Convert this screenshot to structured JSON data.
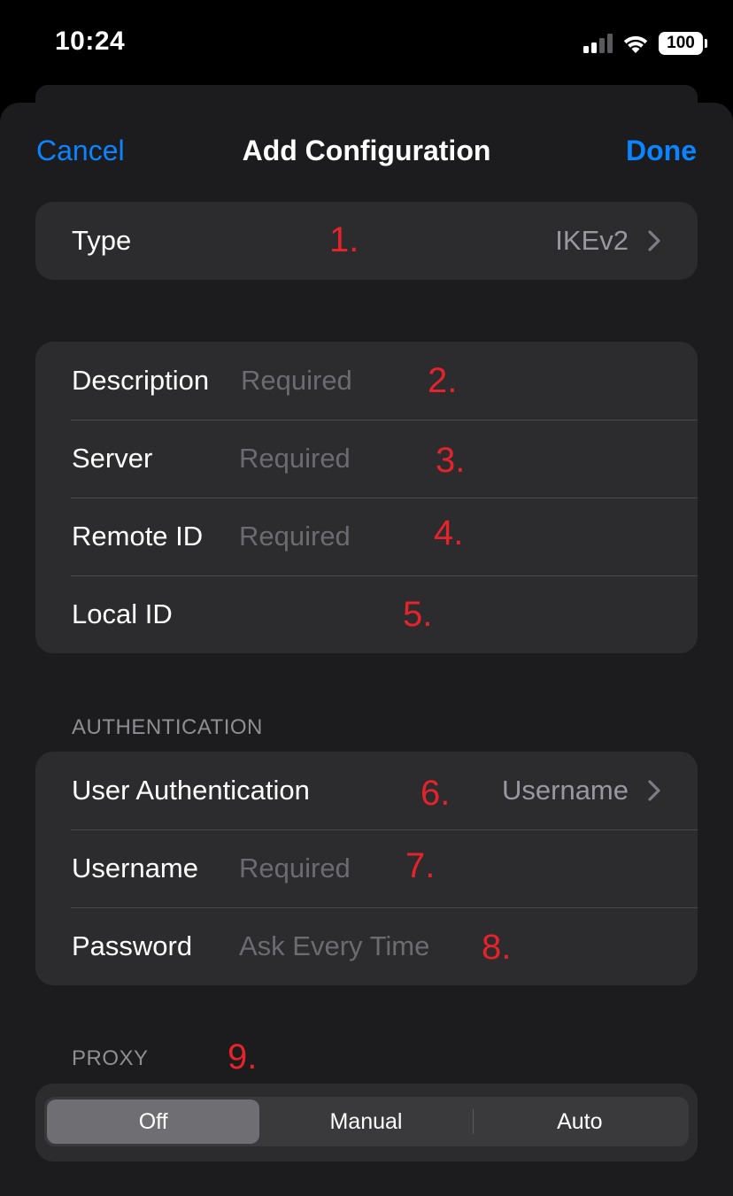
{
  "status": {
    "time": "10:24",
    "battery": "100"
  },
  "nav": {
    "cancel": "Cancel",
    "title": "Add Configuration",
    "done": "Done"
  },
  "type_row": {
    "label": "Type",
    "value": "IKEv2",
    "marker": "1."
  },
  "connection": {
    "description": {
      "label": "Description",
      "placeholder": "Required",
      "marker": "2."
    },
    "server": {
      "label": "Server",
      "placeholder": "Required",
      "marker": "3."
    },
    "remote_id": {
      "label": "Remote ID",
      "placeholder": "Required",
      "marker": "4."
    },
    "local_id": {
      "label": "Local ID",
      "placeholder": "",
      "marker": "5."
    }
  },
  "authentication": {
    "header": "AUTHENTICATION",
    "user_auth": {
      "label": "User Authentication",
      "value": "Username",
      "marker": "6."
    },
    "username": {
      "label": "Username",
      "placeholder": "Required",
      "marker": "7."
    },
    "password": {
      "label": "Password",
      "placeholder": "Ask Every Time",
      "marker": "8."
    }
  },
  "proxy": {
    "header": "PROXY",
    "marker": "9.",
    "options": [
      "Off",
      "Manual",
      "Auto"
    ],
    "selected": "Off"
  },
  "colors": {
    "accent": "#0a84ff",
    "marker": "#e5232b",
    "group_bg": "#2c2c2e",
    "sheet_bg": "#1c1c1e"
  }
}
